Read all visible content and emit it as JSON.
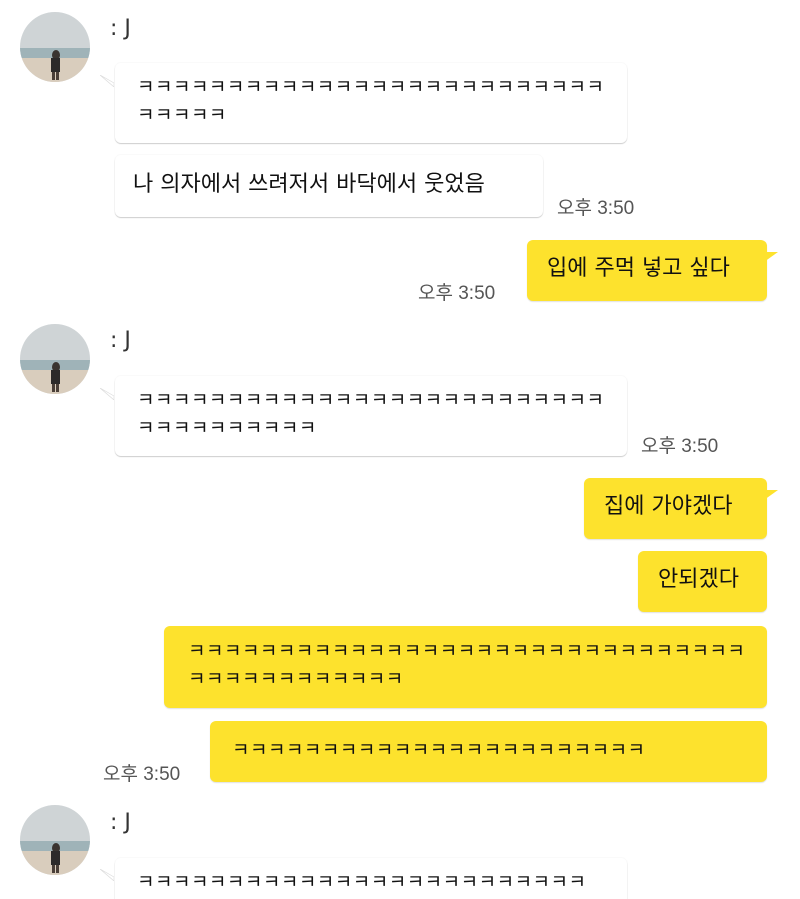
{
  "colors": {
    "outgoing_bubble": "#fde22d",
    "incoming_bubble": "#ffffff",
    "timestamp": "#555555"
  },
  "avatar_icon": "beach-photo-avatar",
  "groups": [
    {
      "sender": ": J",
      "messages": [
        "ㅋㅋㅋㅋㅋㅋㅋㅋㅋㅋㅋㅋㅋㅋㅋㅋㅋㅋㅋㅋㅋㅋㅋㅋㅋㅋㅋㅋㅋㅋㅋ",
        "나 의자에서 쓰려저서 바닥에서 웃었음"
      ],
      "time": "오후 3:50"
    },
    {
      "outgoing": [
        "입에 주먹 넣고 싶다"
      ],
      "time": "오후 3:50"
    },
    {
      "sender": ": J",
      "messages": [
        "ㅋㅋㅋㅋㅋㅋㅋㅋㅋㅋㅋㅋㅋㅋㅋㅋㅋㅋㅋㅋㅋㅋㅋㅋㅋㅋㅋㅋㅋㅋㅋㅋㅋㅋㅋㅋ"
      ],
      "time": "오후 3:50"
    },
    {
      "outgoing": [
        "집에 가야겠다",
        "안되겠다",
        "ㅋㅋㅋㅋㅋㅋㅋㅋㅋㅋㅋㅋㅋㅋㅋㅋㅋㅋㅋㅋㅋㅋㅋㅋㅋㅋㅋㅋㅋㅋㅋㅋㅋㅋㅋㅋㅋㅋㅋㅋㅋㅋㅋ",
        "ㅋㅋㅋㅋㅋㅋㅋㅋㅋㅋㅋㅋㅋㅋㅋㅋㅋㅋㅋㅋㅋㅋㅋ"
      ],
      "time": "오후 3:50"
    },
    {
      "sender": ": J",
      "messages": [
        "ㅋㅋㅋㅋㅋㅋㅋㅋㅋㅋㅋㅋㅋㅋㅋㅋㅋㅋㅋㅋㅋㅋㅋㅋㅋ"
      ]
    }
  ]
}
